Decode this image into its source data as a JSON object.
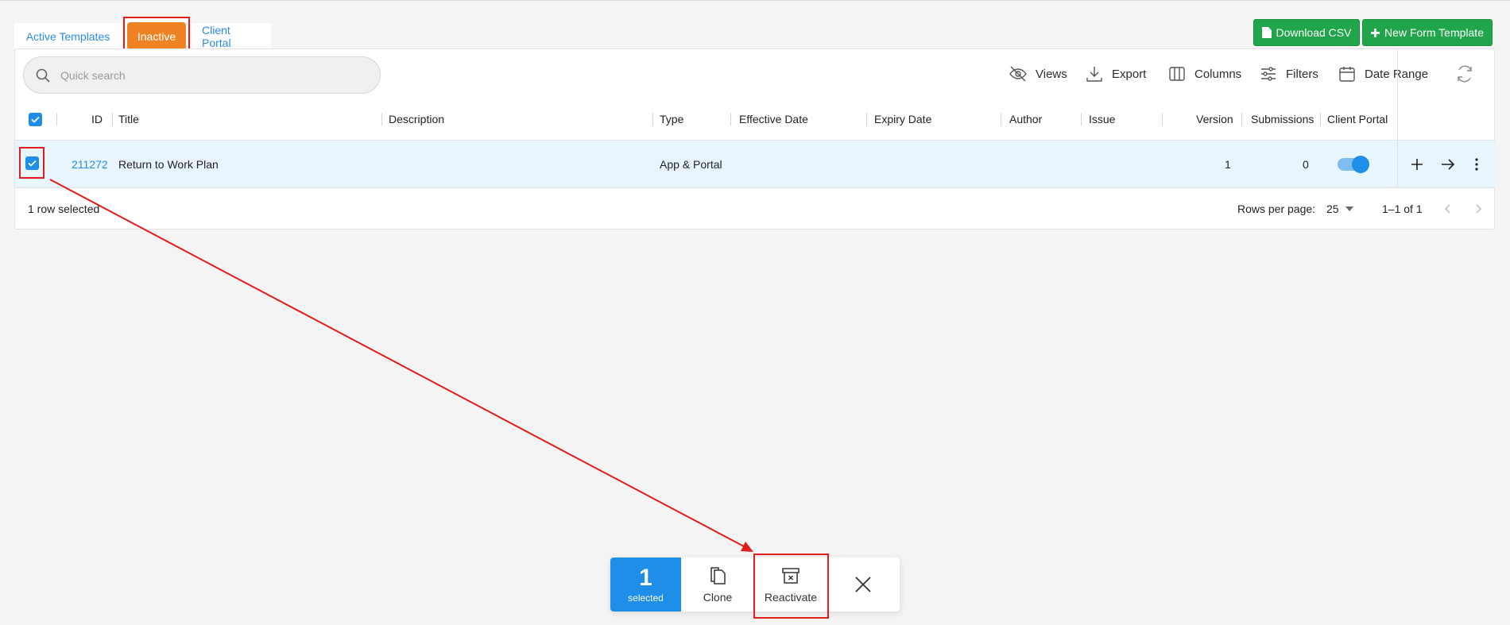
{
  "tabs": {
    "active_templates": "Active Templates",
    "inactive": "Inactive",
    "client_portal": "Client Portal"
  },
  "buttons": {
    "download_csv": "Download CSV",
    "new_form_template": "New Form Template"
  },
  "search": {
    "placeholder": "Quick search"
  },
  "toolbar": {
    "views": "Views",
    "export": "Export",
    "columns": "Columns",
    "filters": "Filters",
    "date_range": "Date Range"
  },
  "columns": {
    "id": "ID",
    "title": "Title",
    "description": "Description",
    "type": "Type",
    "effective_date": "Effective Date",
    "expiry_date": "Expiry Date",
    "author": "Author",
    "issue": "Issue",
    "version": "Version",
    "submissions": "Submissions",
    "client_portal": "Client Portal"
  },
  "rows": [
    {
      "id": "211272",
      "title": "Return to Work Plan",
      "description": "",
      "type": "App & Portal",
      "effective_date": "",
      "expiry_date": "",
      "author": "",
      "issue": "",
      "version": "1",
      "submissions": "0",
      "client_portal": true,
      "selected": true
    }
  ],
  "footer": {
    "selected_text": "1 row selected",
    "rows_per_page_label": "Rows per page:",
    "rows_per_page_value": "25",
    "range": "1–1 of 1"
  },
  "bulk": {
    "count": "1",
    "count_label": "selected",
    "clone": "Clone",
    "reactivate": "Reactivate"
  },
  "colors": {
    "accent_blue": "#1f8ee8",
    "tab_active": "#ef8323",
    "green": "#21a54a",
    "annotation_red": "#e31b1b"
  }
}
